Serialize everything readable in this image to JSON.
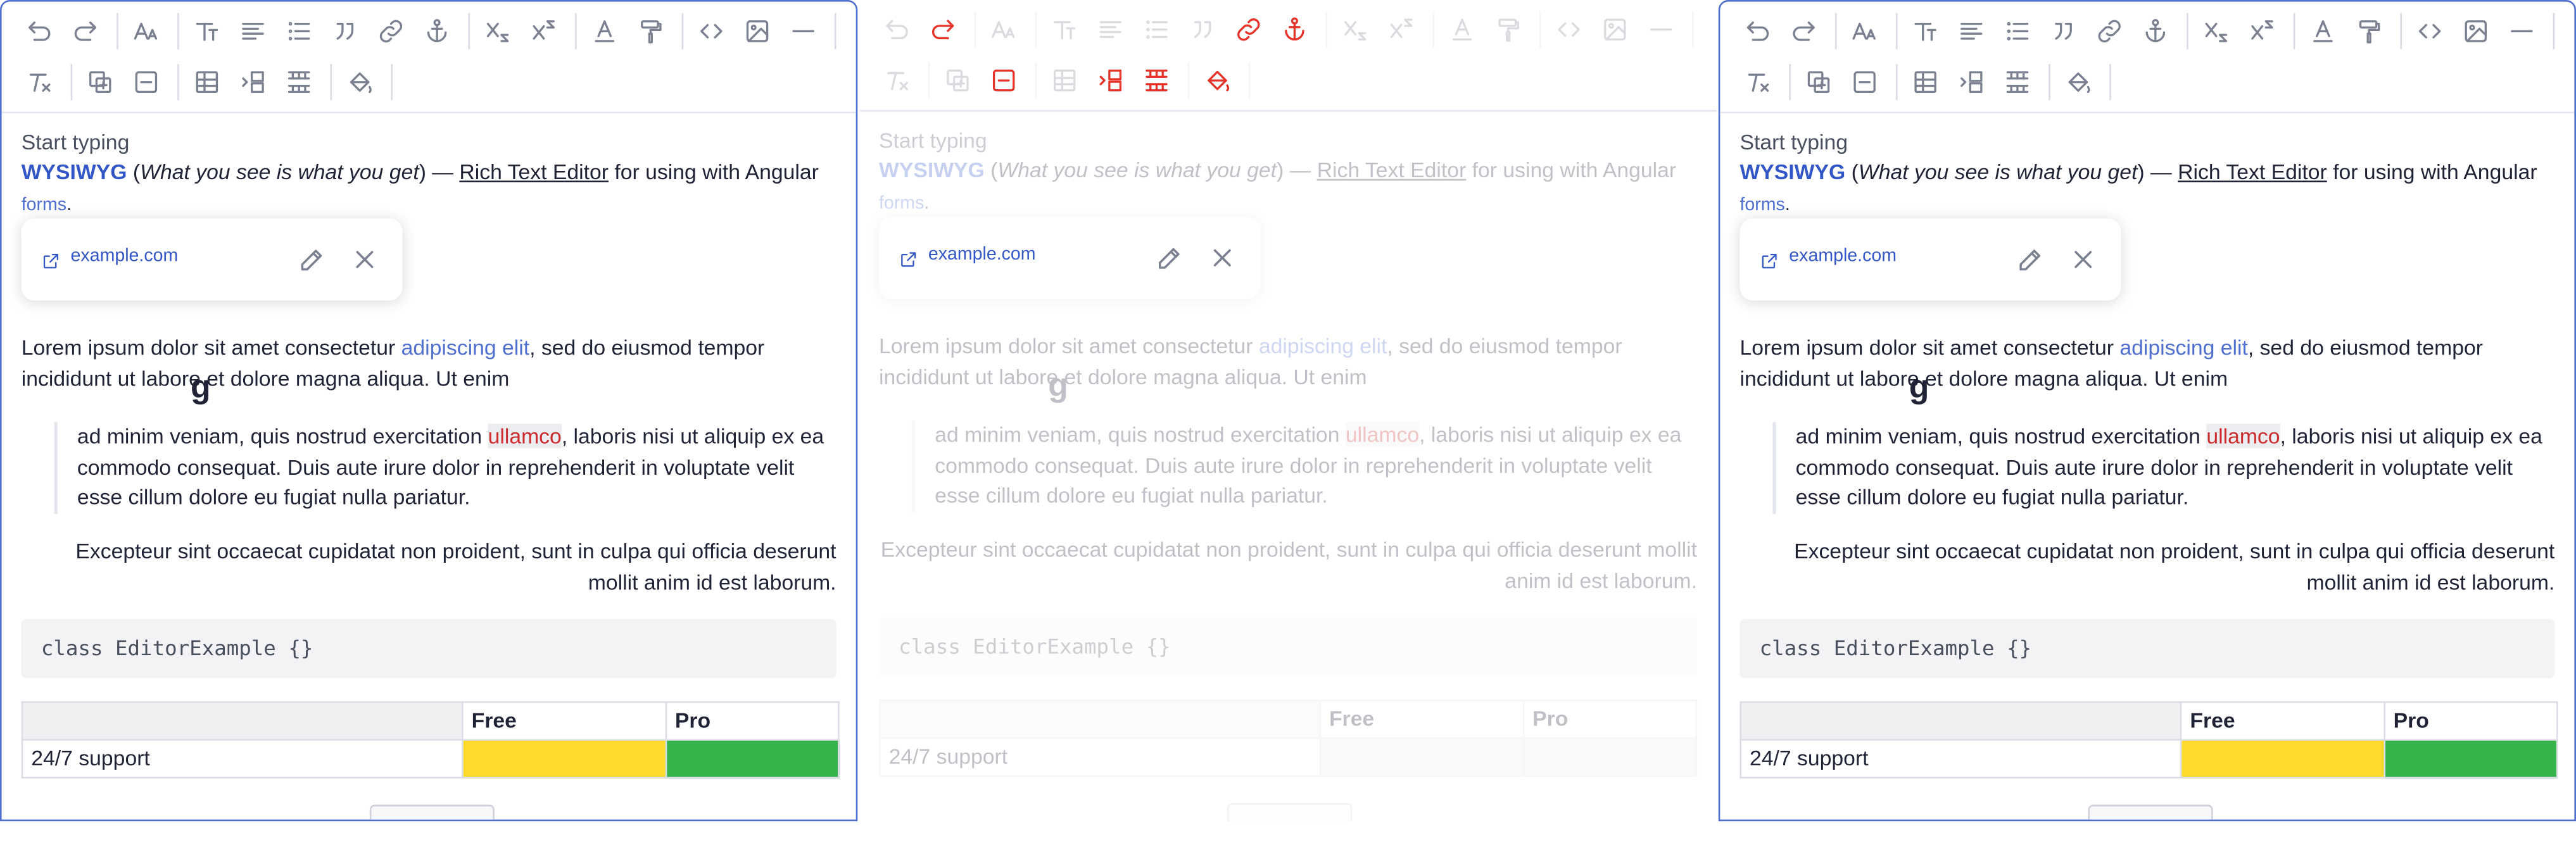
{
  "editor": {
    "placeholder": "Start typing",
    "intro": {
      "brand": "WYSIWYG",
      "open_paren": " (",
      "meaning": "What you see is what you get",
      "close_text": ") — ",
      "rte_link": "Rich Text Editor",
      "tail": " for using with Angular"
    },
    "forms_link": "forms",
    "forms_tail": ".",
    "paragraph": {
      "before": "Lorem ipsum dolor sit amet consectetur ",
      "link": "adipiscing elit",
      "after": ", sed do eiusmod tempor incididunt ut labore et dolore magna aliqua. Ut enim"
    },
    "quote": {
      "before": "ad minim veniam, quis nostrud exercitation ",
      "highlight": "ullamco",
      "after": ", laboris nisi ut aliquip ex ea commodo consequat. Duis aute irure dolor in reprehenderit in voluptate velit esse cillum dolore eu fugiat nulla pariatur."
    },
    "right_aligned": "Excepteur sint occaecat cupidatat non proident, sunt in culpa qui officia deserunt mollit anim id est laborum.",
    "code": "class EditorExample {}",
    "table": {
      "headers": [
        "",
        "Free",
        "Pro"
      ],
      "rows": [
        [
          "24/7 support",
          "",
          ""
        ]
      ]
    },
    "link_popup": {
      "url": "example.com"
    }
  },
  "toolbar": {
    "row1": [
      "undo-icon",
      "redo-icon",
      "font-size-icon",
      "text-style-icon",
      "align-icon",
      "list-icon",
      "quote-icon",
      "link-icon",
      "anchor-icon",
      "subscript-icon",
      "superscript-icon",
      "text-color-icon",
      "paint-format-icon",
      "code-icon",
      "image-icon",
      "horizontal-rule-icon"
    ],
    "row2": [
      "clear-format-icon",
      "insert-table-icon",
      "delete-table-icon",
      "table-icon",
      "insert-column-icon",
      "merge-cells-icon",
      "cell-color-icon"
    ],
    "highlighted_in_middle": [
      "redo-icon",
      "link-icon",
      "anchor-icon",
      "delete-table-icon",
      "insert-column-icon",
      "merge-cells-icon",
      "cell-color-icon"
    ],
    "highlight_color": "#e5332a"
  },
  "colors": {
    "accent": "#4e6fcf",
    "link": "#3457c8",
    "free_cell": "#fdda2c",
    "pro_cell": "#35b44b"
  }
}
